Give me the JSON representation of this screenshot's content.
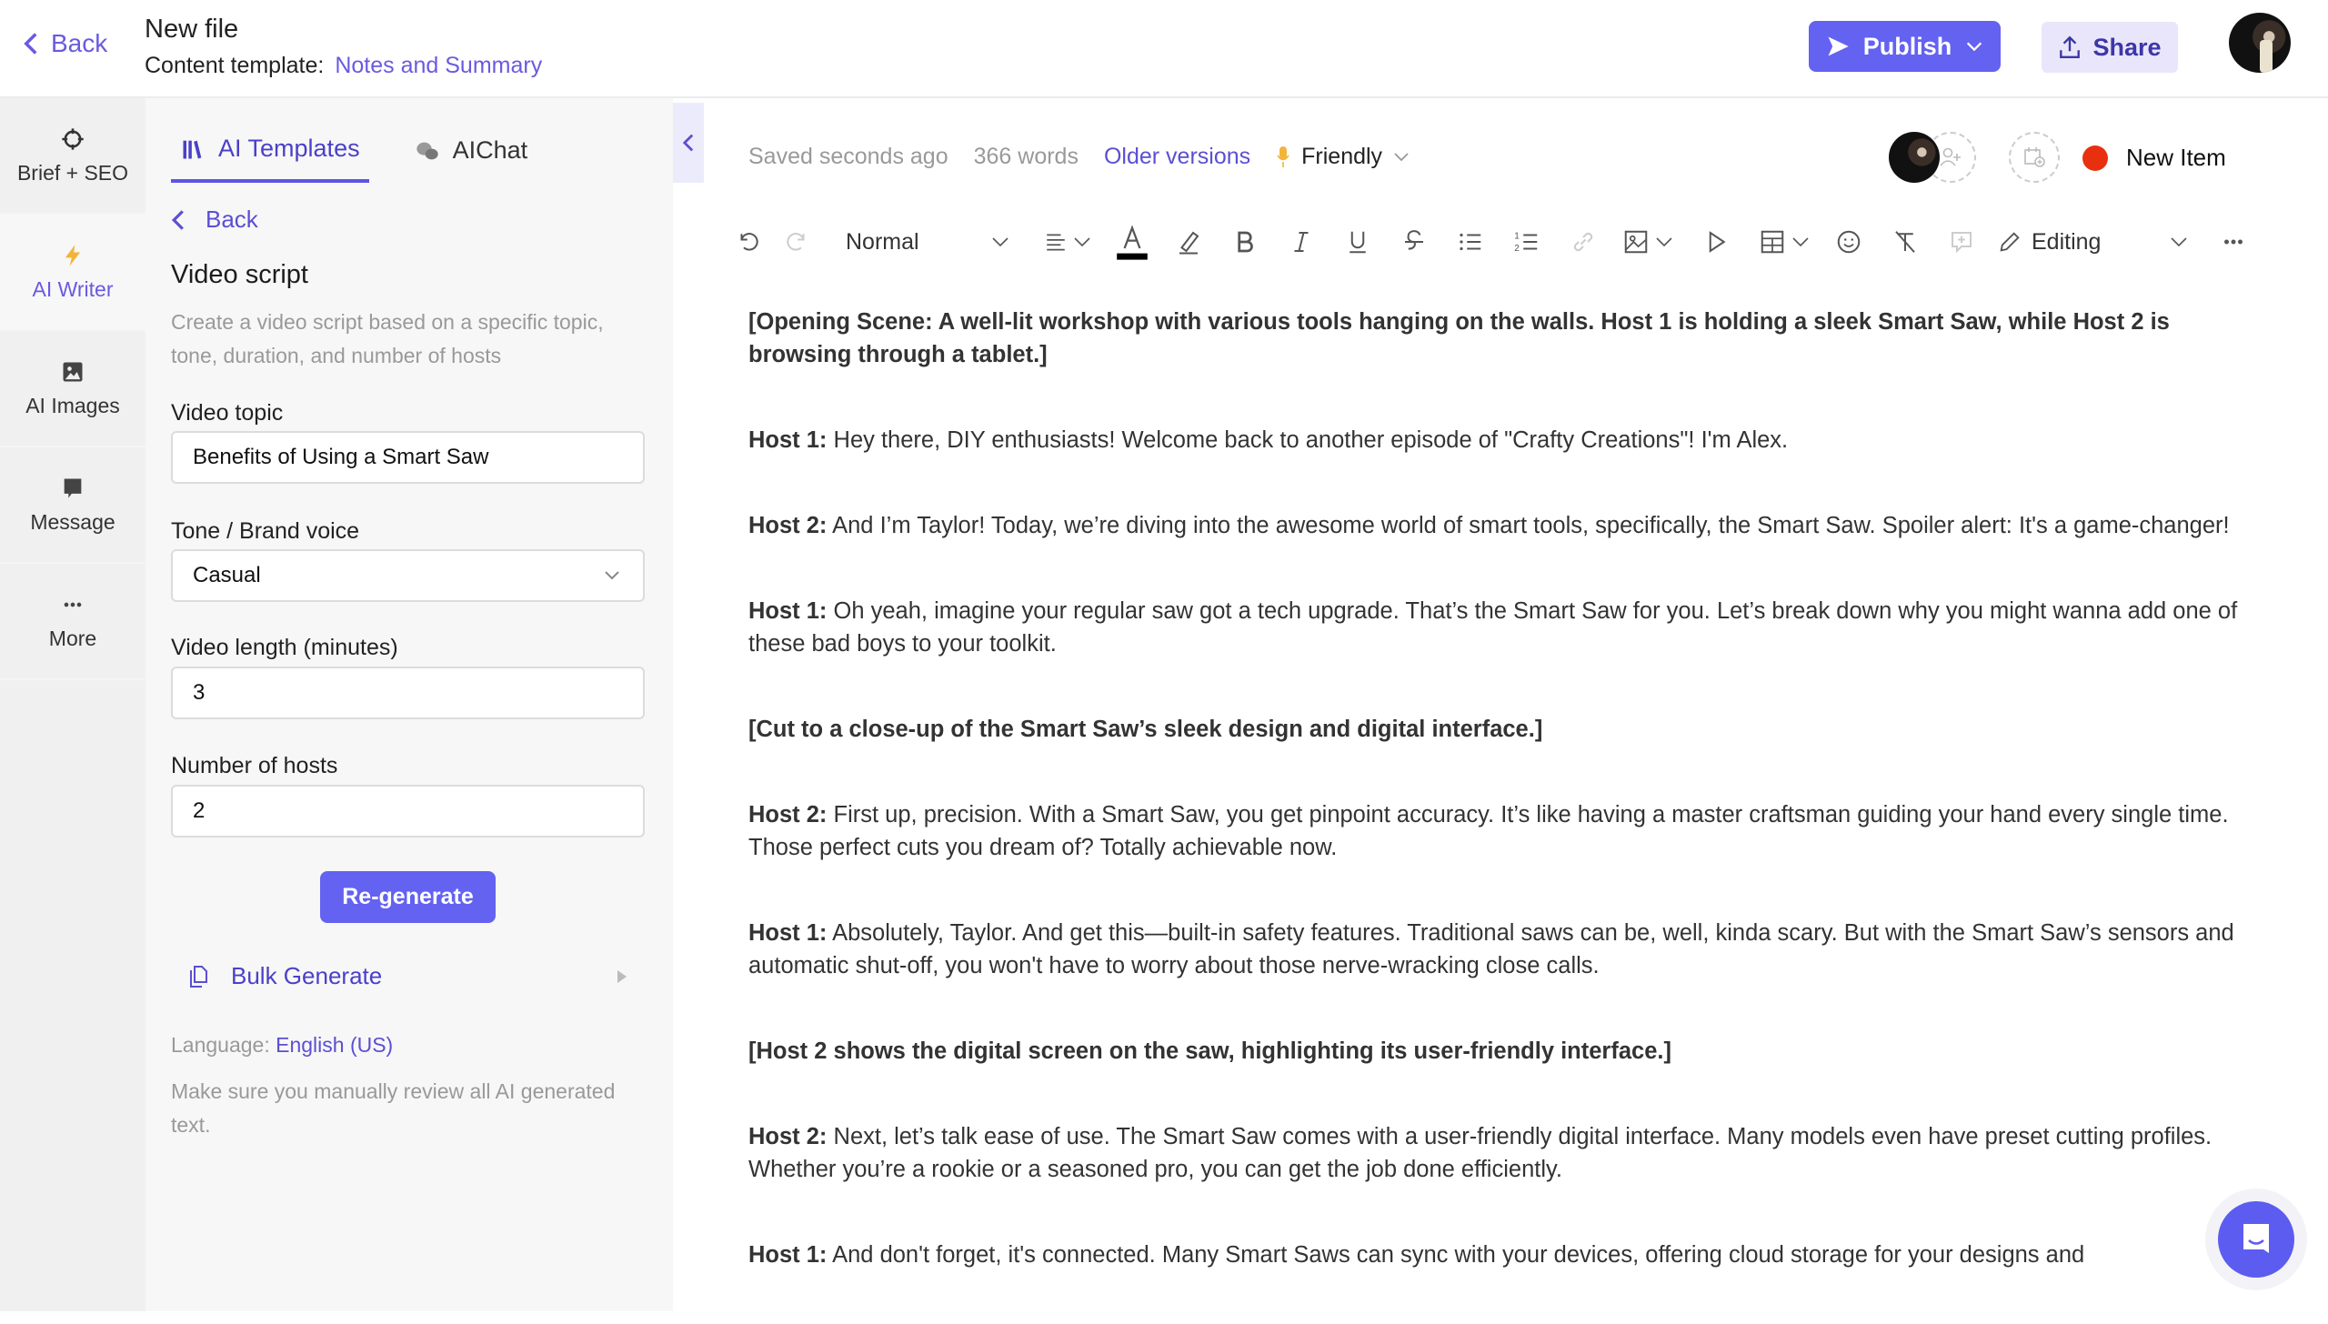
{
  "header": {
    "back_label": "Back",
    "file_title": "New file",
    "template_prefix": "Content template:",
    "template_name": "Notes and Summary",
    "publish_label": "Publish",
    "share_label": "Share"
  },
  "colors": {
    "accent": "#6462f0",
    "accent_text": "#5b4fd2",
    "status_dot": "#e8300f",
    "share_bg": "#e9e6fb"
  },
  "rail": {
    "items": [
      {
        "label": "Brief + SEO",
        "icon": "crosshair-icon"
      },
      {
        "label": "AI Writer",
        "icon": "lightning-icon",
        "active": true
      },
      {
        "label": "AI Images",
        "icon": "image-icon"
      },
      {
        "label": "Message",
        "icon": "message-icon"
      },
      {
        "label": "More",
        "icon": "more-icon"
      }
    ]
  },
  "panel": {
    "tabs": [
      {
        "label": "AI Templates",
        "active": true
      },
      {
        "label": "AIChat",
        "active": false
      }
    ],
    "back_label": "Back",
    "title": "Video script",
    "description": "Create a video script based on a specific topic, tone, duration, and number of hosts",
    "fields": {
      "topic_label": "Video topic",
      "topic_value": "Benefits of Using a Smart Saw",
      "tone_label": "Tone / Brand voice",
      "tone_value": "Casual",
      "length_label": "Video length (minutes)",
      "length_value": "3",
      "hosts_label": "Number of hosts",
      "hosts_value": "2"
    },
    "regenerate_label": "Re-generate",
    "bulk_label": "Bulk Generate",
    "language_prefix": "Language:",
    "language_value": "English (US)",
    "disclaimer": "Make sure you manually review all AI generated text."
  },
  "editor": {
    "saved_status": "Saved seconds ago",
    "word_count": "366 words",
    "older_versions": "Older versions",
    "tone": "Friendly",
    "new_item_label": "New Item",
    "toolbar": {
      "style": "Normal",
      "mode": "Editing"
    },
    "paragraphs": [
      {
        "type": "scene",
        "text": "[Opening Scene: A well-lit workshop with various tools hanging on the walls. Host 1 is holding a sleek Smart Saw, while Host 2 is browsing through a tablet.]"
      },
      {
        "type": "line",
        "speaker": "Host 1:",
        "text": " Hey there, DIY enthusiasts! Welcome back to another episode of \"Crafty Creations\"! I'm Alex."
      },
      {
        "type": "line",
        "speaker": "Host 2:",
        "text": " And I’m Taylor! Today, we’re diving into the awesome world of smart tools, specifically, the Smart Saw. Spoiler alert: It's a game-changer!"
      },
      {
        "type": "line",
        "speaker": "Host 1:",
        "text": " Oh yeah, imagine your regular saw got a tech upgrade. That’s the Smart Saw for you. Let’s break down why you might wanna add one of these bad boys to your toolkit."
      },
      {
        "type": "scene",
        "text": "[Cut to a close-up of the Smart Saw’s sleek design and digital interface.]"
      },
      {
        "type": "line",
        "speaker": "Host 2:",
        "text": " First up, precision. With a Smart Saw, you get pinpoint accuracy. It’s like having a master craftsman guiding your hand every single time. Those perfect cuts you dream of? Totally achievable now."
      },
      {
        "type": "line",
        "speaker": "Host 1:",
        "text": " Absolutely, Taylor. And get this—built-in safety features. Traditional saws can be, well, kinda scary. But with the Smart Saw’s sensors and automatic shut-off, you won't have to worry about those nerve-wracking close calls."
      },
      {
        "type": "scene",
        "text": "[Host 2 shows the digital screen on the saw, highlighting its user-friendly interface.]"
      },
      {
        "type": "line",
        "speaker": "Host 2:",
        "text": " Next, let’s talk ease of use. The Smart Saw comes with a user-friendly digital interface. Many models even have preset cutting profiles. Whether you’re a rookie or a seasoned pro, you can get the job done efficiently."
      },
      {
        "type": "line",
        "speaker": "Host 1:",
        "text": " And don't forget, it's connected. Many Smart Saws can sync with your devices, offering cloud storage for your designs and"
      }
    ]
  }
}
